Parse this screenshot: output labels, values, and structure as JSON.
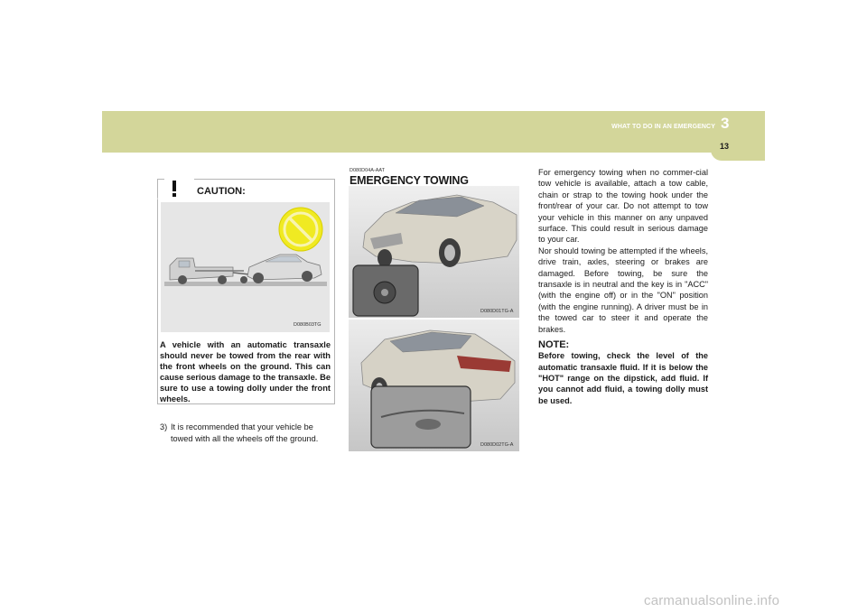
{
  "header": {
    "section_label": "WHAT TO DO IN AN EMERGENCY",
    "chapter_number": "3",
    "page_number": "13",
    "band_color": "#d3d69a"
  },
  "caution": {
    "title": "CAUTION:",
    "icon": "warning-icon",
    "illustration_caption": "D080B03TG",
    "text": "A vehicle with an automatic transaxle should never be towed from the rear with the front wheels on the ground. This can cause serious damage to the transaxle. Be sure to use a towing dolly under the front wheels."
  },
  "recommendation": {
    "number": "3)",
    "text": "It is recommended that your vehicle be towed with all the wheels off the ground."
  },
  "emergency_towing": {
    "code": "D080D04A-AAT",
    "heading": "EMERGENCY TOWING",
    "photo_1_caption": "D080D01TG-A",
    "photo_2_caption": "D080D02TG-A",
    "paragraph_1": "For emergency towing when no commer-cial tow vehicle is available, attach a tow cable, chain or strap to the towing hook under the front/rear of your car. Do not attempt to tow your vehicle in this manner on any unpaved surface. This could result in serious damage to your car.",
    "paragraph_2": "Nor should towing be attempted if the wheels, drive train, axles, steering or brakes are damaged. Before towing, be sure the transaxle is in neutral and the key is in \"ACC\" (with the engine off) or in the \"ON\" position (with the engine running).  A driver must be in the towed car to steer it and operate the brakes.",
    "note_heading": "NOTE:",
    "note_text": "Before towing, check the level of the automatic transaxle fluid. If it is below the \"HOT\" range on the dipstick, add fluid. If you cannot add fluid, a towing dolly must be used."
  },
  "watermark": "carmanualsonline.info"
}
